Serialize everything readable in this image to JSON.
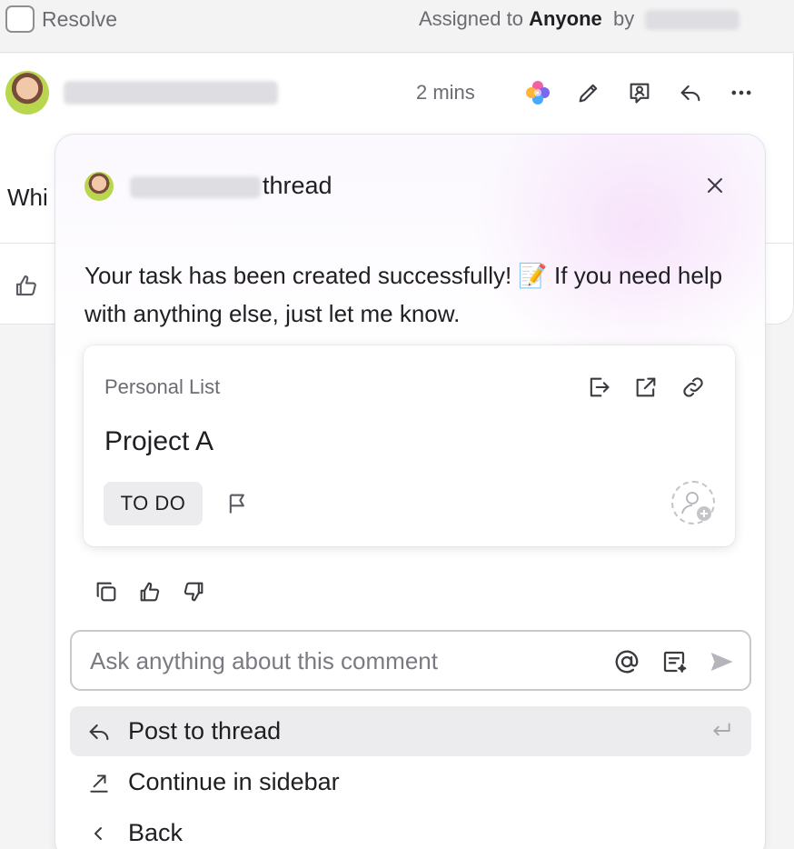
{
  "resolve": {
    "label": "Resolve"
  },
  "assignment": {
    "prefix": "Assigned to",
    "assignee": "Anyone",
    "by_label": "by"
  },
  "comment": {
    "time_ago": "2 mins",
    "text_preview": "Whi"
  },
  "thread": {
    "title_suffix": "thread",
    "message": "Your task has been created successfully! 📝 If you need help with anything else, just let me know.",
    "task": {
      "list_name": "Personal List",
      "title": "Project A",
      "status": "TO DO"
    }
  },
  "ask_input": {
    "placeholder": "Ask anything about this comment",
    "value": ""
  },
  "menu": {
    "items": [
      {
        "label": "Post to thread"
      },
      {
        "label": "Continue in sidebar"
      },
      {
        "label": "Back"
      }
    ]
  },
  "colors": {
    "accent_purple": "#7b68ee",
    "text": "#1f1f23",
    "muted": "#6b6b73"
  }
}
